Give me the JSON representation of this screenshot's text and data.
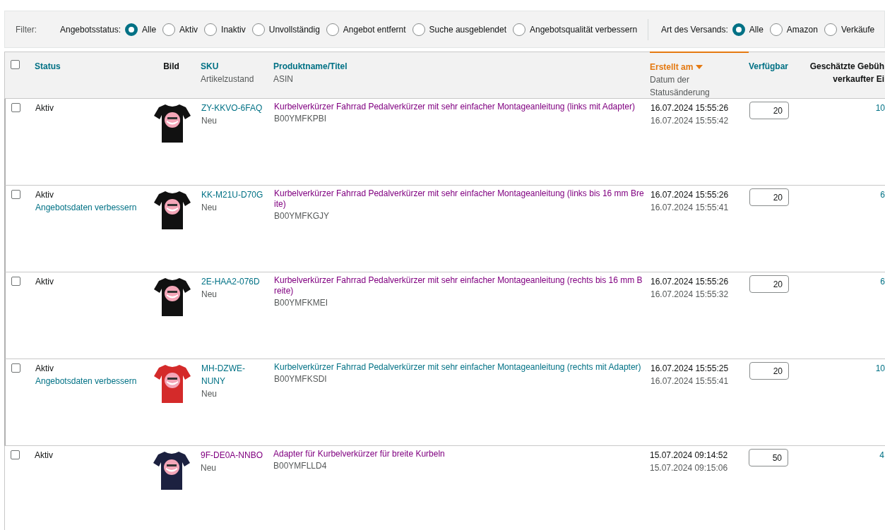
{
  "filter": {
    "label": "Filter:",
    "groups": [
      {
        "label": "Angebotsstatus:",
        "options": [
          {
            "label": "Alle",
            "selected": true
          },
          {
            "label": "Aktiv",
            "selected": false
          },
          {
            "label": "Inaktiv",
            "selected": false
          },
          {
            "label": "Unvollständig",
            "selected": false
          },
          {
            "label": "Angebot entfernt",
            "selected": false
          },
          {
            "label": "Suche ausgeblendet",
            "selected": false
          },
          {
            "label": "Angebotsqualität verbessern",
            "selected": false
          }
        ]
      },
      {
        "label": "Art des Versands:",
        "options": [
          {
            "label": "Alle",
            "selected": true
          },
          {
            "label": "Amazon",
            "selected": false
          },
          {
            "label": "Verkäufe",
            "selected": false
          }
        ]
      }
    ]
  },
  "table": {
    "select_all": {
      "checked": false
    },
    "columns": [
      {
        "kind": "check"
      },
      {
        "kind": "status",
        "label": "Status"
      },
      {
        "label": "Bild"
      },
      {
        "kind": "sku",
        "label": "SKU",
        "sub": "Artikelzustand"
      },
      {
        "kind": "title",
        "label": "Produktname/Titel",
        "sub": "ASIN"
      },
      {
        "kind": "date",
        "label": "Erstellt am",
        "sub": "Datum der Statusänderung",
        "sorted": true
      },
      {
        "kind": "qty",
        "label": "Verfügbar"
      },
      {
        "kind": "fee",
        "label": "Geschätzte Gebüh",
        "sub": "verkaufter Ei"
      }
    ],
    "rows": [
      {
        "checked": false,
        "status": "Aktiv",
        "sku": "ZY-KKVO-6FAQ",
        "sku_visited": false,
        "condition": "Neu",
        "title": "Kurbelverkürzer Fahrrad Pedalverkürzer mit sehr einfacher Montageanleitung (links mit Adapter)",
        "title_visited": true,
        "asin": "B00YMFKPBI",
        "created": "16.07.2024 15:55:26",
        "changed": "16.07.2024 15:55:42",
        "available": "20",
        "fee": "10"
      },
      {
        "checked": false,
        "status": "Aktiv",
        "action": "Angebotsdaten verbessern",
        "sku": "KK-M21U-D70G",
        "sku_visited": false,
        "condition": "Neu",
        "title": "Kurbelverkürzer Fahrrad Pedalverkürzer mit sehr einfacher Montageanleitung (links bis 16 mm Breite)",
        "title_visited": true,
        "asin": "B00YMFKGJY",
        "created": "16.07.2024 15:55:26",
        "changed": "16.07.2024 15:55:41",
        "available": "20",
        "fee": "6"
      },
      {
        "checked": false,
        "status": "Aktiv",
        "sku": "2E-HAA2-076D",
        "sku_visited": false,
        "condition": "Neu",
        "title": "Kurbelverkürzer Fahrrad Pedalverkürzer mit sehr einfacher Montageanleitung (rechts bis 16 mm Breite)",
        "title_visited": true,
        "asin": "B00YMFKMEI",
        "created": "16.07.2024 15:55:26",
        "changed": "16.07.2024 15:55:32",
        "available": "20",
        "fee": "6"
      },
      {
        "checked": false,
        "status": "Aktiv",
        "action": "Angebotsdaten verbessern",
        "sku": "MH-DZWE-NUNY",
        "sku_visited": false,
        "condition": "Neu",
        "title": "Kurbelverkürzer Fahrrad Pedalverkürzer mit sehr einfacher Montageanleitung (rechts mit Adapter)",
        "title_visited": false,
        "asin": "B00YMFKSDI",
        "created": "16.07.2024 15:55:25",
        "changed": "16.07.2024 15:55:41",
        "available": "20",
        "fee": "10"
      },
      {
        "checked": false,
        "status": "Aktiv",
        "sku": "9F-DE0A-NNBO",
        "sku_visited": true,
        "condition": "Neu",
        "title": "Adapter für Kurbelverkürzer für breite Kurbeln",
        "title_visited": true,
        "asin": "B00YMFLLD4",
        "created": "15.07.2024 09:14:52",
        "changed": "15.07.2024 09:15:06",
        "available": "50",
        "fee": "4"
      }
    ]
  }
}
